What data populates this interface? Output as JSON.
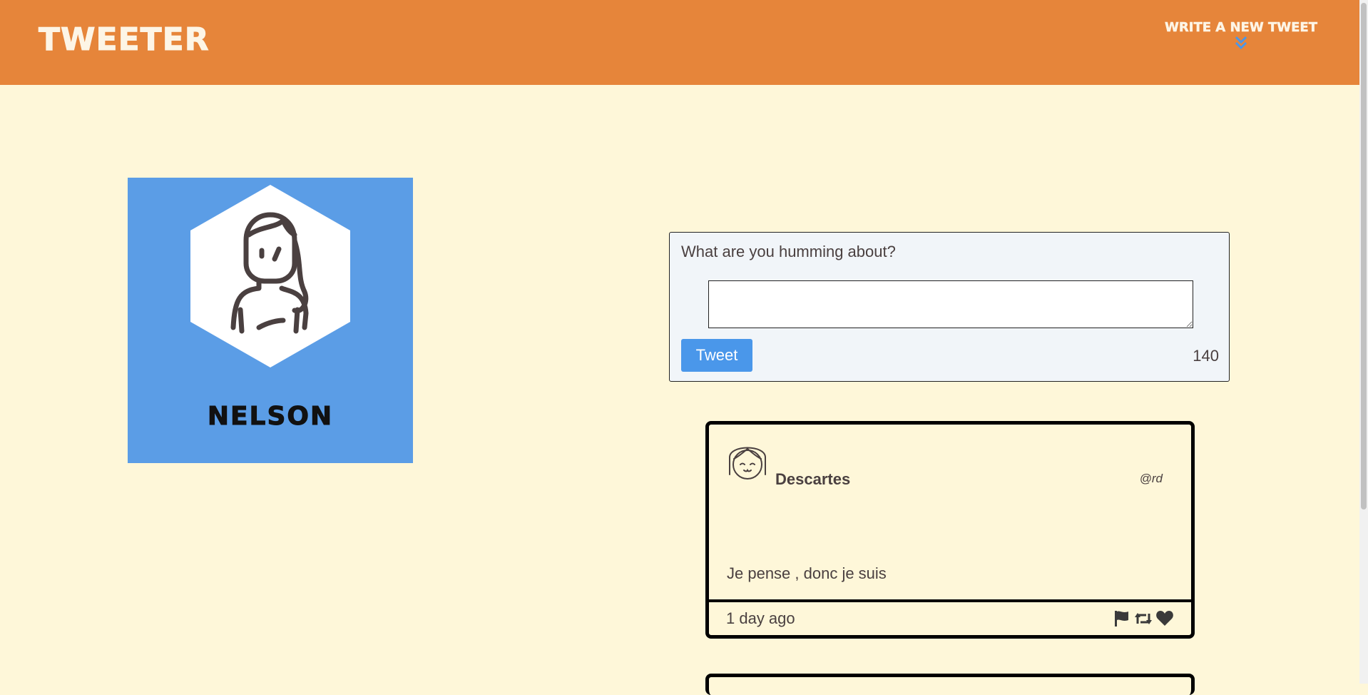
{
  "nav": {
    "brand": "TWEETER",
    "write_new_label": "WRITE A NEW TWEET",
    "write_new_icon": "double-chevron-down-icon"
  },
  "profile": {
    "name": "NELSON",
    "avatar_icon": "woman-avatar-icon",
    "background_color": "#5b9de6"
  },
  "compose": {
    "label": "What are you humming about?",
    "textarea_value": "",
    "button_label": "Tweet",
    "counter": "140"
  },
  "tweets": [
    {
      "name": "Descartes",
      "handle": "@rd",
      "body": "Je pense , donc je suis",
      "time": "1 day ago",
      "avatar_icon": "girl-bangs-avatar-icon",
      "actions": [
        "flag-icon",
        "retweet-icon",
        "heart-icon"
      ]
    }
  ],
  "colors": {
    "header": "#e6853a",
    "page_background": "#fef7d9",
    "accent": "#4a97ea"
  }
}
